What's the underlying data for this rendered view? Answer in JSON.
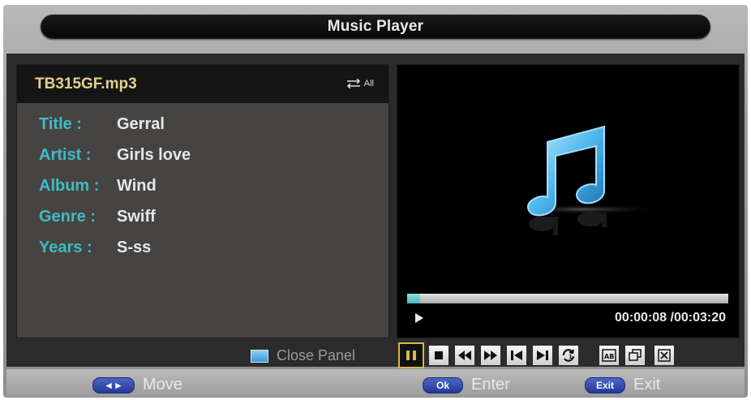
{
  "window": {
    "title": "Music Player"
  },
  "track": {
    "filename": "TB315GF.mp3",
    "repeat_mode": "All",
    "fields": [
      {
        "label": "Title :",
        "value": "Gerral"
      },
      {
        "label": "Artist :",
        "value": "Girls love"
      },
      {
        "label": "Album :",
        "value": "Wind"
      },
      {
        "label": "Genre :",
        "value": "Swiff"
      },
      {
        "label": "Years :",
        "value": "S-ss"
      }
    ]
  },
  "player": {
    "progress_fraction": 0.04,
    "timecode": "00:00:08 /00:03:20",
    "state_icon": "play-icon"
  },
  "controls": {
    "close_panel_label": "Close Panel",
    "buttons": [
      "pause-icon",
      "stop-icon",
      "rewind-icon",
      "fast-forward-icon",
      "previous-icon",
      "next-icon",
      "repeat-icon",
      "ab-repeat-icon",
      "playlist-icon",
      "close-icon"
    ]
  },
  "footer": {
    "move": {
      "key": "◄►",
      "label": "Move"
    },
    "enter": {
      "key": "Ok",
      "label": "Enter"
    },
    "exit": {
      "key": "Exit",
      "label": "Exit"
    }
  },
  "colors": {
    "accent_cyan": "#3fbcc4",
    "filename_gold": "#e3cf8f",
    "selected_border": "#d9b64a"
  }
}
